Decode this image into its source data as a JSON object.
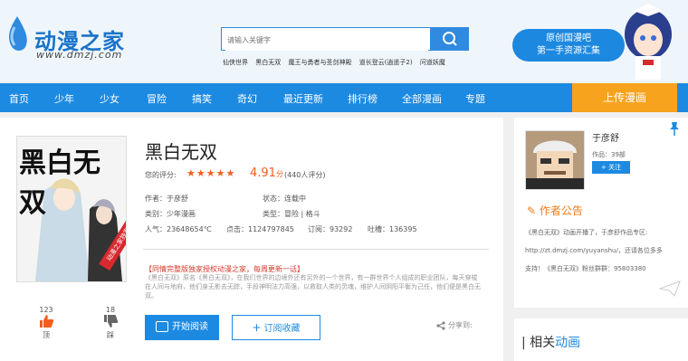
{
  "header": {
    "logo_text": "动漫之家",
    "logo_url": "www.dmzj.com",
    "search_placeholder": "请输入关键字",
    "hot_searches": [
      "仙侠世界",
      "黑白无双",
      "魔王与勇者与圣剑神殿",
      "道长登云(逍遥子2)",
      "问道妖魔"
    ],
    "ad_line1": "原创国漫吧",
    "ad_line2": "第一手资源汇集"
  },
  "nav": {
    "items": [
      "首页",
      "少年",
      "少女",
      "冒险",
      "搞笑",
      "奇幻",
      "最近更新",
      "排行榜",
      "全部漫画",
      "专题"
    ],
    "upload_label": "上传漫画"
  },
  "comic": {
    "cover_title": "黑白无双",
    "cover_badge": "动漫之家独家",
    "title": "黑白无双",
    "rating_label": "您的评分:",
    "stars": "★★★★★",
    "score": "4.91",
    "score_unit": "分",
    "score_count": "(440人评分)",
    "author": "作者：于彦舒",
    "status": "状态：连载中",
    "category": "类别：少年漫画",
    "genre": "类型：冒险 | 格斗",
    "popularity": "人气：23648654℃",
    "clicks": "点击：1124797845",
    "subscribe_count": "订阅：93292",
    "tucao": "吐槽：136395",
    "desc_head": "【同情完整版独家授权动漫之家，每周更新一话】",
    "desc": "《黑白无双》原名《黑白无双》，在我们世界的边境外还有另外的一个世界，有一群世界个人组成的职业团队，每天穿梭在人间与地府，他们身无影去无踪，手段神明法力高强，以救取人类的灵魂，维护人间阴阳平衡为己任，他们便是黑白无双。",
    "read_button": "开始阅读",
    "subscribe_button": "订阅收藏",
    "share_label": "分享到:",
    "up_count": "123",
    "up_label": "顶",
    "down_count": "18",
    "down_label": "踩"
  },
  "sidebar": {
    "author_name": "于彦舒",
    "works": "作品：39部",
    "follow_label": "+ 关注",
    "notice_title": "作者公告",
    "notice_lines": [
      "《黑白无双》动画开播了，于彦舒作品专区:",
      "http://zt.dmzj.com/yuyanshu/，还请各位多多",
      "支持！《黑白无双》粉丝群群：95803380"
    ],
    "related_title_1": "相关",
    "related_title_2": "动画"
  },
  "colors": {
    "brand_blue": "#1d8ae2",
    "upload_orange": "#f7a31e",
    "score_orange": "#f25e1e"
  }
}
